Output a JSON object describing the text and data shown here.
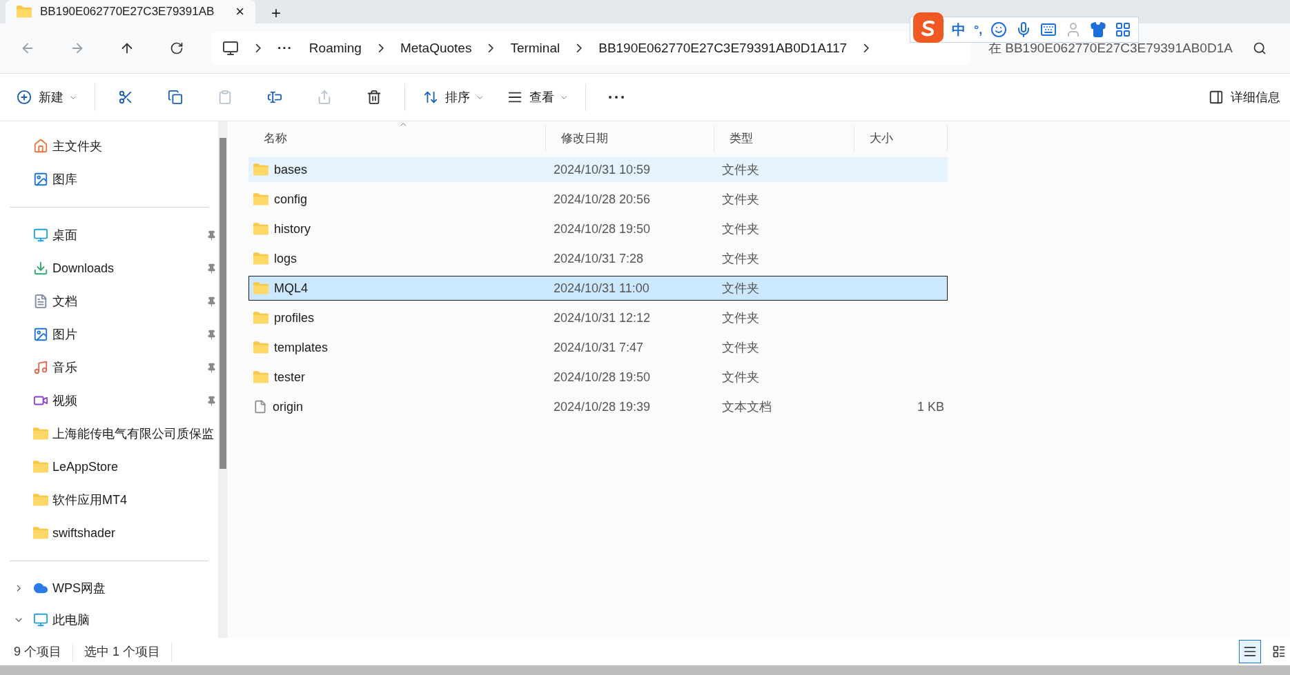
{
  "tab": {
    "title": "BB190E062770E27C3E79391AB",
    "close": "×",
    "new": "+"
  },
  "address": {
    "ellipsis": "···",
    "crumbs": [
      "Roaming",
      "MetaQuotes",
      "Terminal",
      "BB190E062770E27C3E79391AB0D1A117"
    ]
  },
  "search": {
    "placeholder": "在 BB190E062770E27C3E79391AB0D1A"
  },
  "ime": {
    "mode": "中",
    "punct": "°,"
  },
  "toolbar": [
    {
      "kind": "new",
      "label": "新建",
      "disabled": false
    },
    {
      "kind": "cut",
      "disabled": false
    },
    {
      "kind": "copy",
      "disabled": false
    },
    {
      "kind": "paste",
      "disabled": true
    },
    {
      "kind": "rename",
      "disabled": false
    },
    {
      "kind": "share",
      "disabled": true
    },
    {
      "kind": "delete",
      "disabled": false
    },
    {
      "kind": "sort",
      "label": "排序",
      "disabled": false
    },
    {
      "kind": "view",
      "label": "查看",
      "disabled": false
    },
    {
      "kind": "more",
      "disabled": false
    }
  ],
  "details_button": "详细信息",
  "sidebar": {
    "groups": [
      [
        {
          "label": "主文件夹",
          "kind": "home",
          "pinned": false
        },
        {
          "label": "图库",
          "kind": "gallery",
          "pinned": false
        }
      ],
      [
        {
          "label": "桌面",
          "kind": "desktop",
          "pinned": true
        },
        {
          "label": "Downloads",
          "kind": "download",
          "pinned": true
        },
        {
          "label": "文档",
          "kind": "document",
          "pinned": true
        },
        {
          "label": "图片",
          "kind": "picture",
          "pinned": true
        },
        {
          "label": "音乐",
          "kind": "music",
          "pinned": true
        },
        {
          "label": "视频",
          "kind": "video",
          "pinned": true
        },
        {
          "label": "上海能传电气有限公司质保监",
          "kind": "folder",
          "pinned": false
        },
        {
          "label": "LeAppStore",
          "kind": "folder",
          "pinned": false
        },
        {
          "label": "软件应用MT4",
          "kind": "folder",
          "pinned": false
        },
        {
          "label": "swiftshader",
          "kind": "folder",
          "pinned": false
        }
      ]
    ],
    "tree": [
      {
        "label": "WPS网盘",
        "kind": "cloud",
        "expanded": false
      },
      {
        "label": "此电脑",
        "kind": "pc",
        "expanded": true
      }
    ]
  },
  "table": {
    "columns": [
      "名称",
      "修改日期",
      "类型",
      "大小"
    ],
    "rows": [
      {
        "name": "bases",
        "kind": "folder",
        "date": "2024/10/31 10:59",
        "type": "文件夹",
        "size": "",
        "selected": false,
        "hovered": true
      },
      {
        "name": "config",
        "kind": "folder",
        "date": "2024/10/28 20:56",
        "type": "文件夹",
        "size": "",
        "selected": false,
        "hovered": false
      },
      {
        "name": "history",
        "kind": "folder",
        "date": "2024/10/28 19:50",
        "type": "文件夹",
        "size": "",
        "selected": false,
        "hovered": false
      },
      {
        "name": "logs",
        "kind": "folder",
        "date": "2024/10/31 7:28",
        "type": "文件夹",
        "size": "",
        "selected": false,
        "hovered": false
      },
      {
        "name": "MQL4",
        "kind": "folder",
        "date": "2024/10/31 11:00",
        "type": "文件夹",
        "size": "",
        "selected": true,
        "hovered": false
      },
      {
        "name": "profiles",
        "kind": "folder",
        "date": "2024/10/31 12:12",
        "type": "文件夹",
        "size": "",
        "selected": false,
        "hovered": false
      },
      {
        "name": "templates",
        "kind": "folder",
        "date": "2024/10/31 7:47",
        "type": "文件夹",
        "size": "",
        "selected": false,
        "hovered": false
      },
      {
        "name": "tester",
        "kind": "folder",
        "date": "2024/10/28 19:50",
        "type": "文件夹",
        "size": "",
        "selected": false,
        "hovered": false
      },
      {
        "name": "origin",
        "kind": "file",
        "date": "2024/10/28 19:39",
        "type": "文本文档",
        "size": "1 KB",
        "selected": false,
        "hovered": false
      }
    ]
  },
  "status_bar": {
    "count": "9 个项目",
    "selection": "选中 1 个项目",
    "view_details_selected": true
  }
}
